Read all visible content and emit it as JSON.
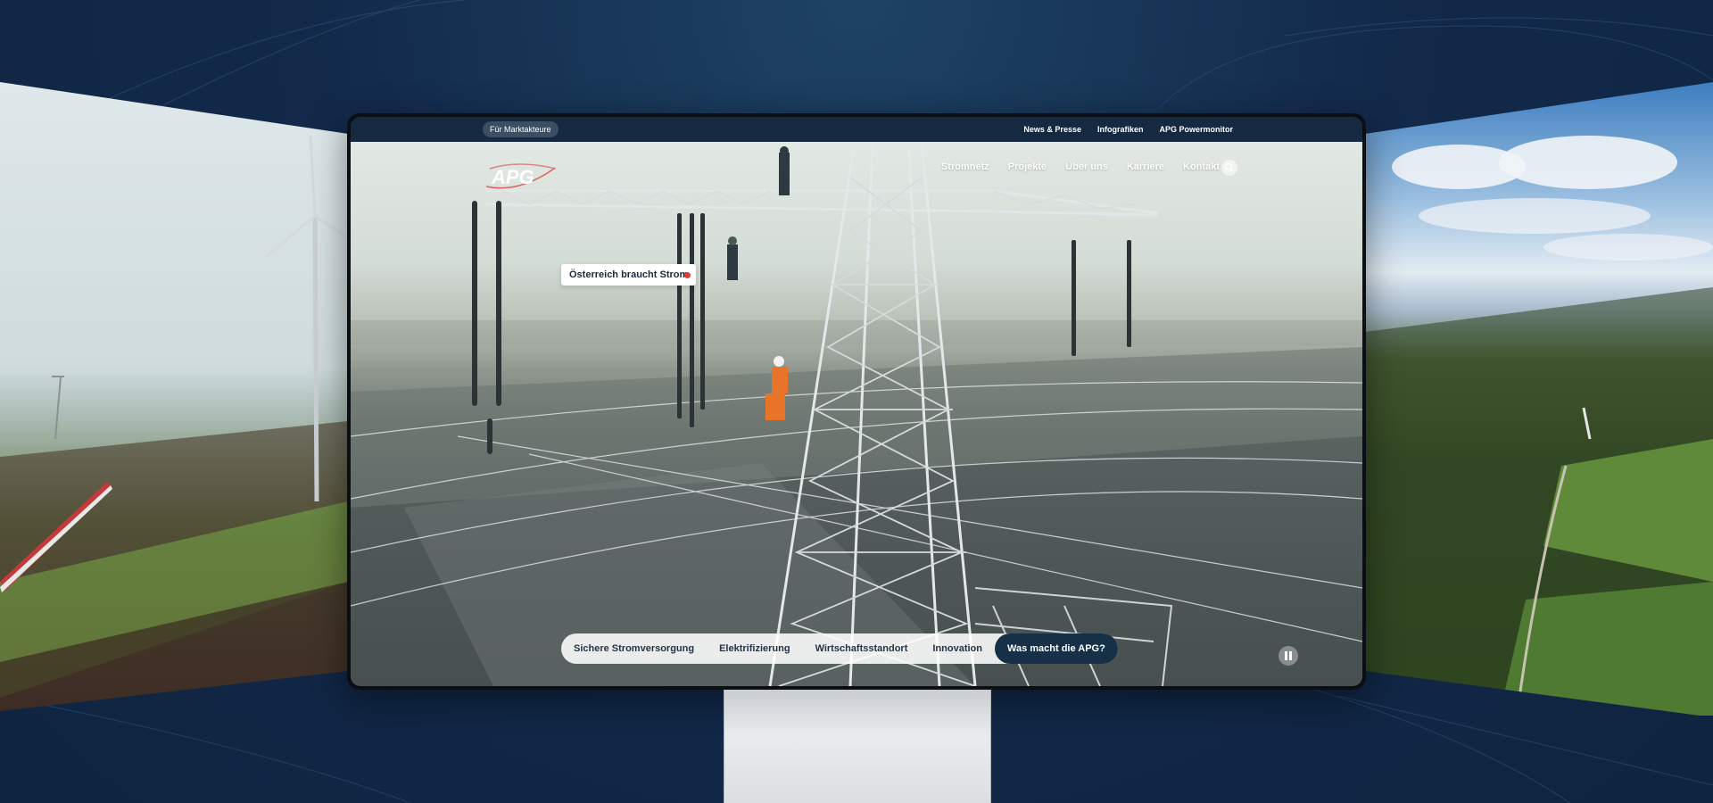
{
  "colors": {
    "nav_dark": "#152a40",
    "accent_red": "#e03a3a",
    "tab_active": "#163048"
  },
  "utility_bar": {
    "market_pill": "Für Marktakteure",
    "links": [
      "News & Presse",
      "Infografiken",
      "APG Powermonitor"
    ]
  },
  "header": {
    "logo_text": "APG",
    "nav": [
      "Stromnetz",
      "Projekte",
      "Über uns",
      "Karriere",
      "Kontakt"
    ],
    "search_icon": "search-icon"
  },
  "hero": {
    "hotspot_label": "Österreich braucht Strom",
    "pause_icon": "pause-icon"
  },
  "topic_tabs": {
    "items": [
      "Sichere Stromversorgung",
      "Elektrifizierung",
      "Wirtschaftsstandort",
      "Innovation"
    ],
    "active": "Was macht die APG?"
  }
}
